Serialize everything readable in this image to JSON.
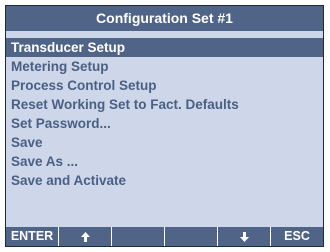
{
  "title": "Configuration Set #1",
  "menu": {
    "selected_index": 0,
    "items": [
      {
        "label": "Transducer Setup"
      },
      {
        "label": "Metering Setup"
      },
      {
        "label": "Process Control Setup"
      },
      {
        "label": "Reset Working Set to Fact. Defaults"
      },
      {
        "label": "Set Password..."
      },
      {
        "label": "Save"
      },
      {
        "label": "Save As ..."
      },
      {
        "label": "Save and Activate"
      }
    ]
  },
  "softkeys": {
    "enter": "ENTER",
    "up_icon": "arrow-up-icon",
    "blank1": "",
    "blank2": "",
    "down_icon": "arrow-down-icon",
    "esc": "ESC"
  },
  "colors": {
    "background": "#ced7ea",
    "bar": "#4f6487",
    "text": "#4a5f84",
    "highlight_text": "#ffffff"
  }
}
